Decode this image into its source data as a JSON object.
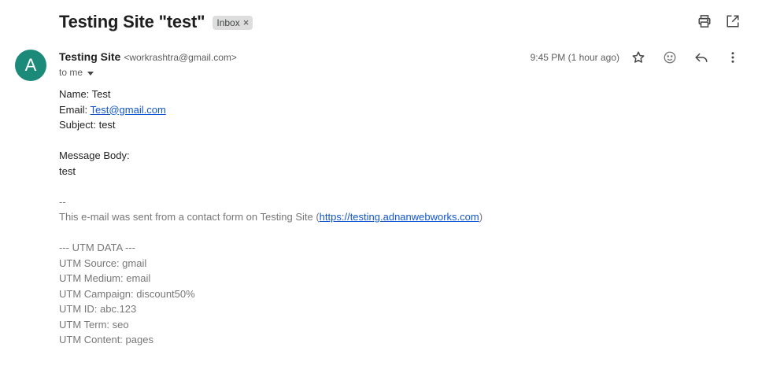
{
  "email": {
    "subject": "Testing Site \"test\"",
    "label_chip": "Inbox",
    "chip_close": "×",
    "avatar_letter": "A",
    "sender_name": "Testing Site",
    "sender_email": "<workrashtra@gmail.com>",
    "to": "to me",
    "timestamp": "9:45 PM (1 hour ago)",
    "icons": {
      "print": "print-icon",
      "open_new_window": "open-in-new-window-icon",
      "star": "star-icon",
      "emoji": "emoji-reaction-icon",
      "reply": "reply-icon",
      "more": "more-vert-icon"
    },
    "colors": {
      "avatar_bg": "#1c8a78",
      "link": "#1155cc"
    }
  },
  "body": {
    "name_label": "Name: ",
    "name_value": "Test",
    "email_label": "Email: ",
    "email_value": "Test@gmail.com",
    "subject_label": "Subject: ",
    "subject_value": "test",
    "message_label": "Message Body:",
    "message_value": "test",
    "signature_sep": "--",
    "footer_prefix": "This e-mail was sent from a contact form on Testing Site (",
    "footer_link": "https://testing.adnanwebworks.com",
    "footer_suffix": ")",
    "utm_header": "--- UTM DATA ---",
    "utm_source": "UTM Source: gmail",
    "utm_medium": "UTM Medium: email",
    "utm_campaign": "UTM Campaign: discount50%",
    "utm_id": "UTM ID: abc.123",
    "utm_term": "UTM Term: seo",
    "utm_content": "UTM Content: pages"
  }
}
